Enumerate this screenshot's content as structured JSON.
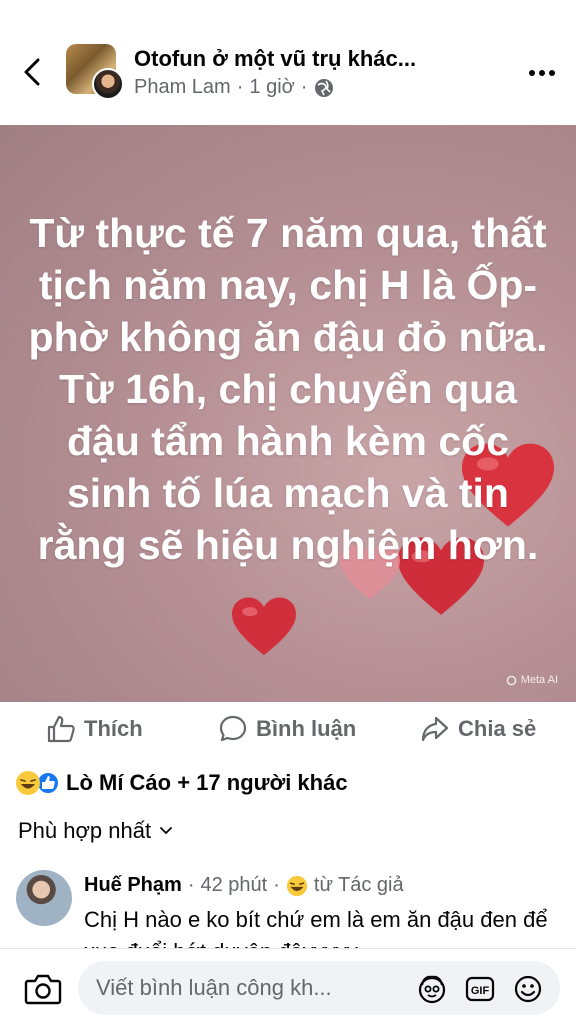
{
  "header": {
    "group_name": "Otofun ở một vũ trụ khác...",
    "author": "Pham Lam",
    "separator": "·",
    "time": "1 giờ"
  },
  "post": {
    "text": "Từ thực tế 7 năm qua, thất tịch năm nay, chị H là Ốp-phờ không ăn đậu đỏ nữa. Từ 16h, chị chuyển qua đậu tẩm hành kèm cốc sinh tố lúa mạch và tin rằng sẽ hiệu nghiệm hơn.",
    "watermark": "Meta AI"
  },
  "actions": {
    "like": "Thích",
    "comment": "Bình luận",
    "share": "Chia sẻ"
  },
  "reactions": {
    "summary": "Lò Mí Cáo + 17 người khác"
  },
  "sort": {
    "label": "Phù hợp nhất"
  },
  "comment": {
    "name": "Huế Phạm",
    "separator": "·",
    "time": "42 phút",
    "badge": "từ Tác giả",
    "text": "Chị H nào e ko bít chứ em là em ăn đậu đen để xua đuổi bớt duyên đâyyyyy"
  },
  "composer": {
    "placeholder": "Viết bình luận công kh..."
  },
  "colors": {
    "accent": "#1877f2",
    "muted": "#65676b",
    "heart": "#d9333f"
  }
}
